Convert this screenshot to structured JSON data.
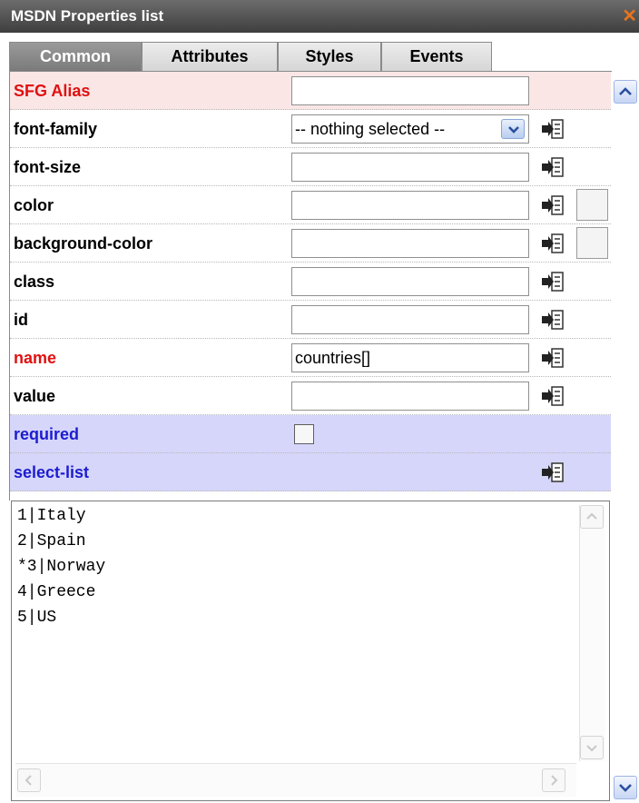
{
  "window": {
    "title": "MSDN Properties list",
    "close_icon": "close-x-icon",
    "accent_color": "#e8741c"
  },
  "tabs": [
    {
      "label": "Common",
      "active": true
    },
    {
      "label": "Attributes",
      "active": false
    },
    {
      "label": "Styles",
      "active": false
    },
    {
      "label": "Events",
      "active": false
    }
  ],
  "properties": {
    "sfg_alias": {
      "label": "SFG Alias",
      "value": ""
    },
    "font_family": {
      "label": "font-family",
      "value": "-- nothing selected --"
    },
    "font_size": {
      "label": "font-size",
      "value": ""
    },
    "color": {
      "label": "color",
      "value": ""
    },
    "background_color": {
      "label": "background-color",
      "value": ""
    },
    "class": {
      "label": "class",
      "value": ""
    },
    "id": {
      "label": "id",
      "value": ""
    },
    "name": {
      "label": "name",
      "value": "countries[]"
    },
    "value": {
      "label": "value",
      "value": ""
    },
    "required": {
      "label": "required",
      "checked": false
    },
    "select_list": {
      "label": "select-list"
    }
  },
  "select_list_text": [
    "1|Italy",
    "2|Spain",
    "*3|Norway",
    "4|Greece",
    "5|US"
  ],
  "colors": {
    "required_label": "#e01010",
    "special_label": "#1c1cd0",
    "alias_row_bg": "#fbe6e6",
    "special_row_bg": "#d6d6fb"
  }
}
